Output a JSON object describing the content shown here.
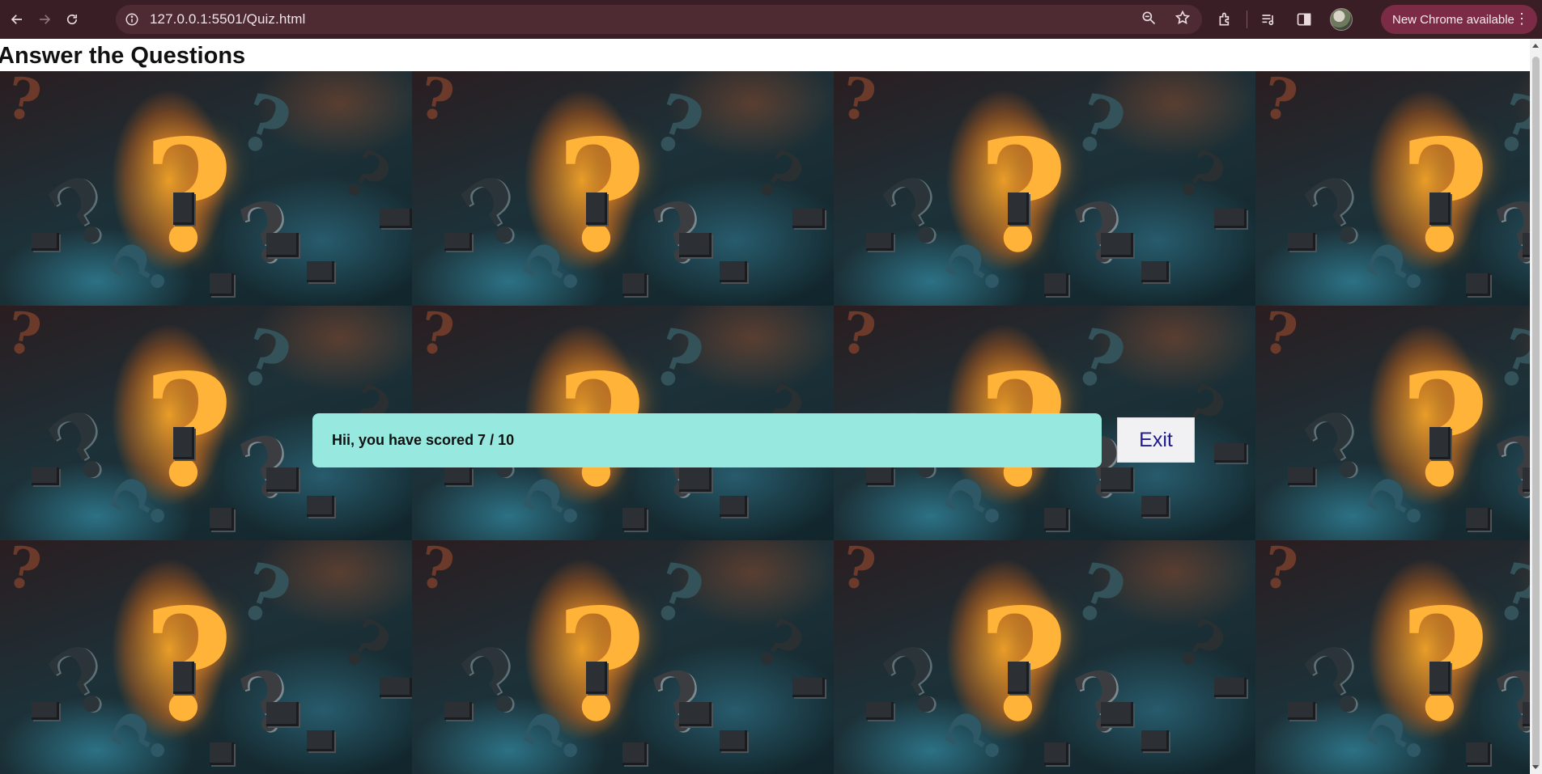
{
  "browser": {
    "url": "127.0.0.1:5501/Quiz.html",
    "update_label": "New Chrome available",
    "icons": [
      "back-icon",
      "forward-icon",
      "reload-icon",
      "site-info-icon",
      "zoom-icon",
      "bookmark-star-icon",
      "extensions-icon",
      "media-controls-icon",
      "side-panel-icon",
      "profile-avatar",
      "more-menu-icon"
    ]
  },
  "page": {
    "title": "Answer the Questions"
  },
  "result": {
    "message": "Hii, you have scored 7 / 10",
    "exit_label": "Exit"
  },
  "colors": {
    "chrome_bg": "#3a1e26",
    "omnibox_bg": "#4e2a33",
    "update_pill": "#7b2b45",
    "result_box": "#97e8df",
    "exit_text": "#1f1a8f"
  }
}
